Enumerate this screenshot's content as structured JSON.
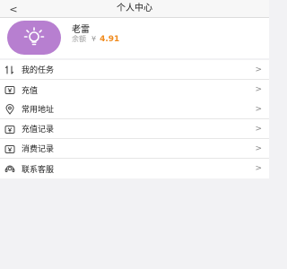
{
  "header": {
    "title": "个人中心",
    "back_glyph": "<"
  },
  "profile": {
    "name": "老雷",
    "balance_label": "余额",
    "currency": "¥",
    "balance": "4.91",
    "avatar_icon": "lightbulb-icon",
    "avatar_color": "#b77fd0",
    "balance_color": "#f08a1c"
  },
  "menu": {
    "group1": [
      {
        "label": "我的任务",
        "icon": "task-sort-icon"
      },
      {
        "label": "充值",
        "icon": "recharge-wallet-icon"
      }
    ],
    "group2": [
      {
        "label": "常用地址",
        "icon": "location-pin-icon"
      },
      {
        "label": "充值记录",
        "icon": "recharge-record-icon"
      },
      {
        "label": "消费记录",
        "icon": "spending-record-icon"
      },
      {
        "label": "联系客服",
        "icon": "customer-service-icon"
      }
    ],
    "chevron_glyph": ">"
  }
}
